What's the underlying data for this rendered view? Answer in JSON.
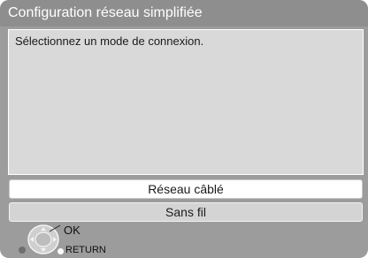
{
  "title": "Configuration réseau simplifiée",
  "message": "Sélectionnez un mode de connexion.",
  "options": [
    {
      "label": "Réseau câblé",
      "selected": true
    },
    {
      "label": "Sans fil",
      "selected": false
    }
  ],
  "footer": {
    "ok_label": "OK",
    "return_label": "RETURN",
    "icons": [
      "dpad-icon",
      "gray-button-icon",
      "return-button-icon"
    ]
  },
  "colors": {
    "screen_bg": "#9c9c9c",
    "title_bg": "#8e8e8e",
    "panel_bg": "#d9d9d9",
    "selected_bg": "#ffffff",
    "option_bg": "#d4d4d4"
  }
}
